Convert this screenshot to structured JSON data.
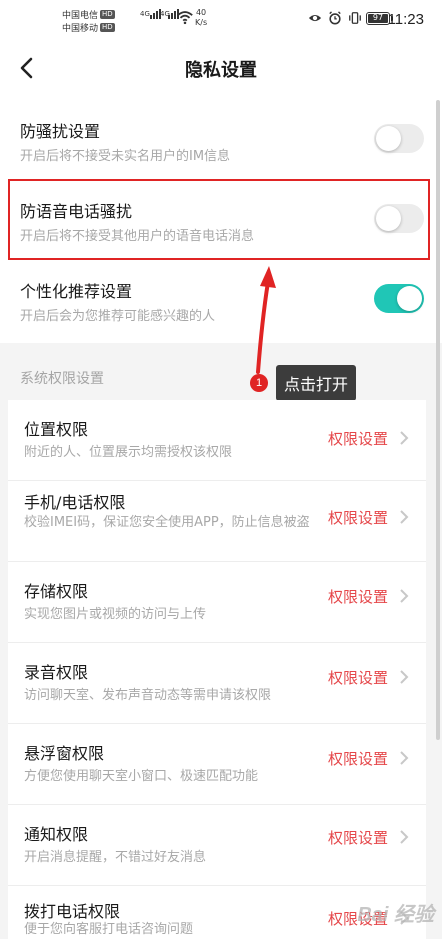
{
  "status_bar": {
    "carrier1": "中国电信",
    "carrier2": "中国移动",
    "hd_badge": "HD",
    "net_a": "4G",
    "net_b": "4G",
    "speed_value": "40",
    "speed_unit": "K/s",
    "battery": "97",
    "time": "11:23"
  },
  "header": {
    "title": "隐私设置"
  },
  "settings": [
    {
      "title": "防骚扰设置",
      "subtitle": "开启后将不接受未实名用户的IM信息",
      "toggle_on": false
    },
    {
      "title": "防语音电话骚扰",
      "subtitle": "开启后将不接受其他用户的语音电话消息",
      "toggle_on": false
    },
    {
      "title": "个性化推荐设置",
      "subtitle": "开启后会为您推荐可能感兴趣的人",
      "toggle_on": true
    }
  ],
  "annotation": {
    "step": "1",
    "text": "点击打开"
  },
  "permissions_section": {
    "title": "系统权限设置",
    "link_label": "权限设置",
    "items": [
      {
        "title": "位置权限",
        "subtitle": "附近的人、位置展示均需授权该权限"
      },
      {
        "title": "手机/电话权限",
        "subtitle": "校验IMEI码，保证您安全使用APP，防止信息被盗"
      },
      {
        "title": "存储权限",
        "subtitle": "实现您图片或视频的访问与上传"
      },
      {
        "title": "录音权限",
        "subtitle": "访问聊天室、发布声音动态等需申请该权限"
      },
      {
        "title": "悬浮窗权限",
        "subtitle": "方便您使用聊天室小窗口、极速匹配功能"
      },
      {
        "title": "通知权限",
        "subtitle": "开启消息提醒，不错过好友消息"
      },
      {
        "title": "拨打电话权限",
        "subtitle": "便于您向客服打电话咨询问题"
      }
    ]
  },
  "colors": {
    "accent_toggle": "#20c6b6",
    "link_red": "#e5474a",
    "highlight_red": "#e02424"
  },
  "watermark": "Bai 经验"
}
